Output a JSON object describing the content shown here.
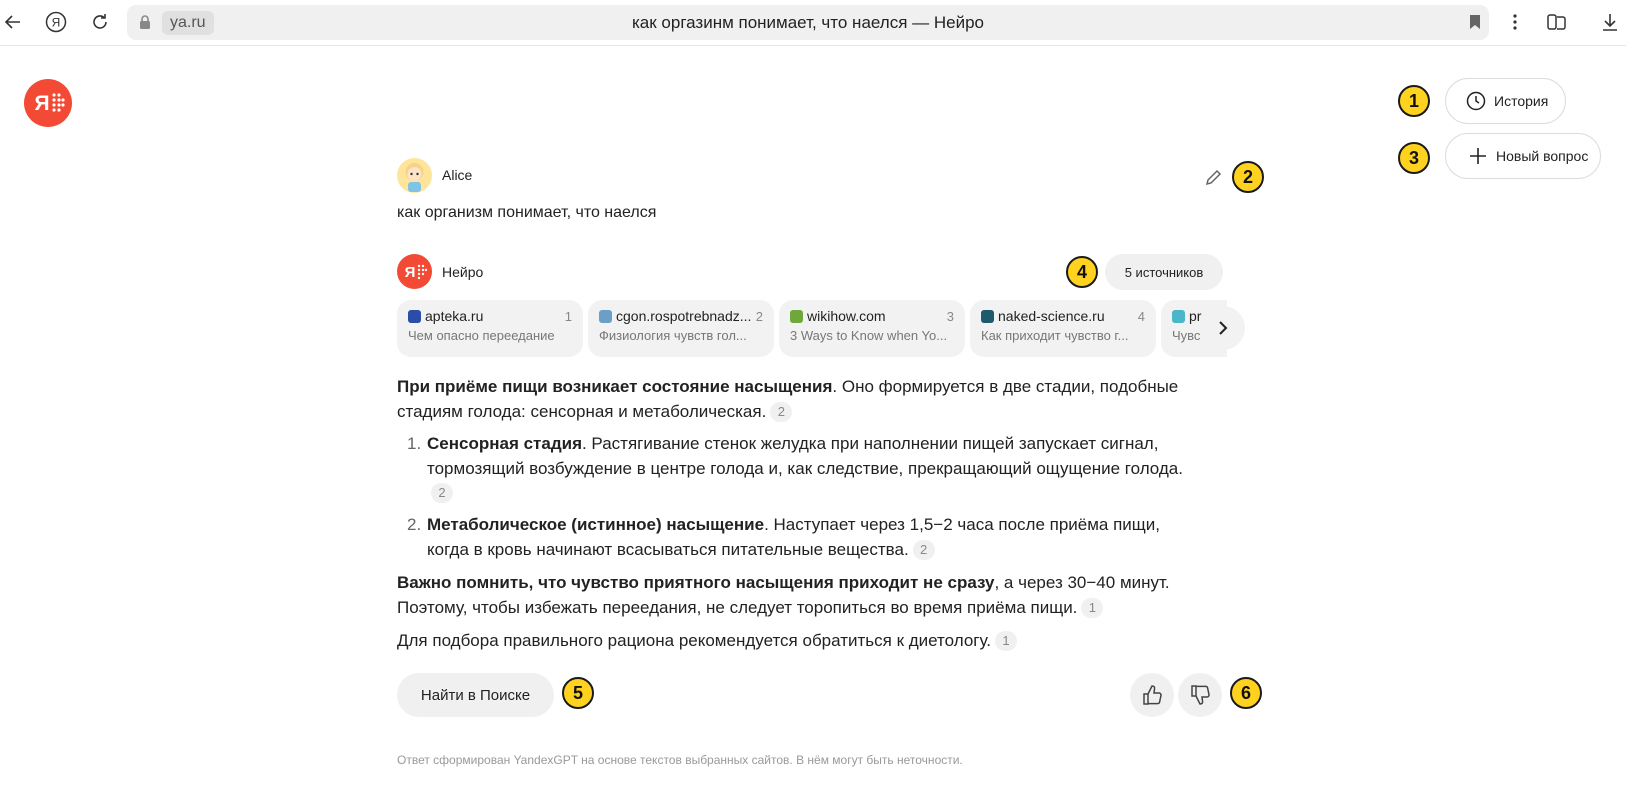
{
  "browser": {
    "domain": "ya.ru",
    "page_title": "как оргазинм понимает, что наелся — Нейро"
  },
  "header": {
    "history_label": "История",
    "new_question_label": "Новый вопрос"
  },
  "markers": [
    "1",
    "2",
    "3",
    "4",
    "5",
    "6"
  ],
  "conversation": {
    "user_name": "Alice",
    "question": "как организм понимает, что наелся",
    "assistant_name": "Нейро",
    "sources_button": "5 источников"
  },
  "sources": [
    {
      "host": "apteka.ru",
      "num": "1",
      "desc": "Чем опасно переедание",
      "color": "#2a4ea8"
    },
    {
      "host": "cgon.rospotrebnadz...",
      "num": "2",
      "desc": "Физиология чувств гол...",
      "color": "#6aa0c8"
    },
    {
      "host": "wikihow.com",
      "num": "3",
      "desc": "3 Ways to Know when Yo...",
      "color": "#6ea83c"
    },
    {
      "host": "naked-science.ru",
      "num": "4",
      "desc": "Как приходит чувство г...",
      "color": "#1d5a6e"
    },
    {
      "host": "pr",
      "num": "",
      "desc": "Чувс",
      "color": "#4bb6c8"
    }
  ],
  "answer": {
    "p1_bold": "При приёме пищи возникает состояние насыщения",
    "p1_rest": ". Оно формируется в две стадии, подобные стадиям голода: сенсорная и метаболическая.",
    "p1_ref": "2",
    "item1_num": "1.",
    "item1_bold": "Сенсорная стадия",
    "item1_rest": ". Растягивание стенок желудка при наполнении пищей запускает сигнал, тормозящий возбуждение в центре голода и, как следствие, прекращающий ощущение голода.",
    "item1_ref": "2",
    "item2_num": "2.",
    "item2_bold": "Метаболическое (истинное) насыщение",
    "item2_rest": ". Наступает через 1,5−2 часа после приёма пищи, когда в кровь начинают всасываться питательные вещества.",
    "item2_ref": "2",
    "p2_bold": "Важно помнить, что чувство приятного насыщения приходит не сразу",
    "p2_rest": ", а через 30−40 минут. Поэтому, чтобы избежать переедания, не следует торопиться во время приёма пищи.",
    "p2_ref": "1",
    "p3": "Для подбора правильного рациона рекомендуется обратиться к диетологу.",
    "p3_ref": "1"
  },
  "actions": {
    "search_label": "Найти в Поиске"
  },
  "footer": "Ответ сформирован YandexGPT на основе текстов выбранных сайтов. В нём могут быть неточности."
}
